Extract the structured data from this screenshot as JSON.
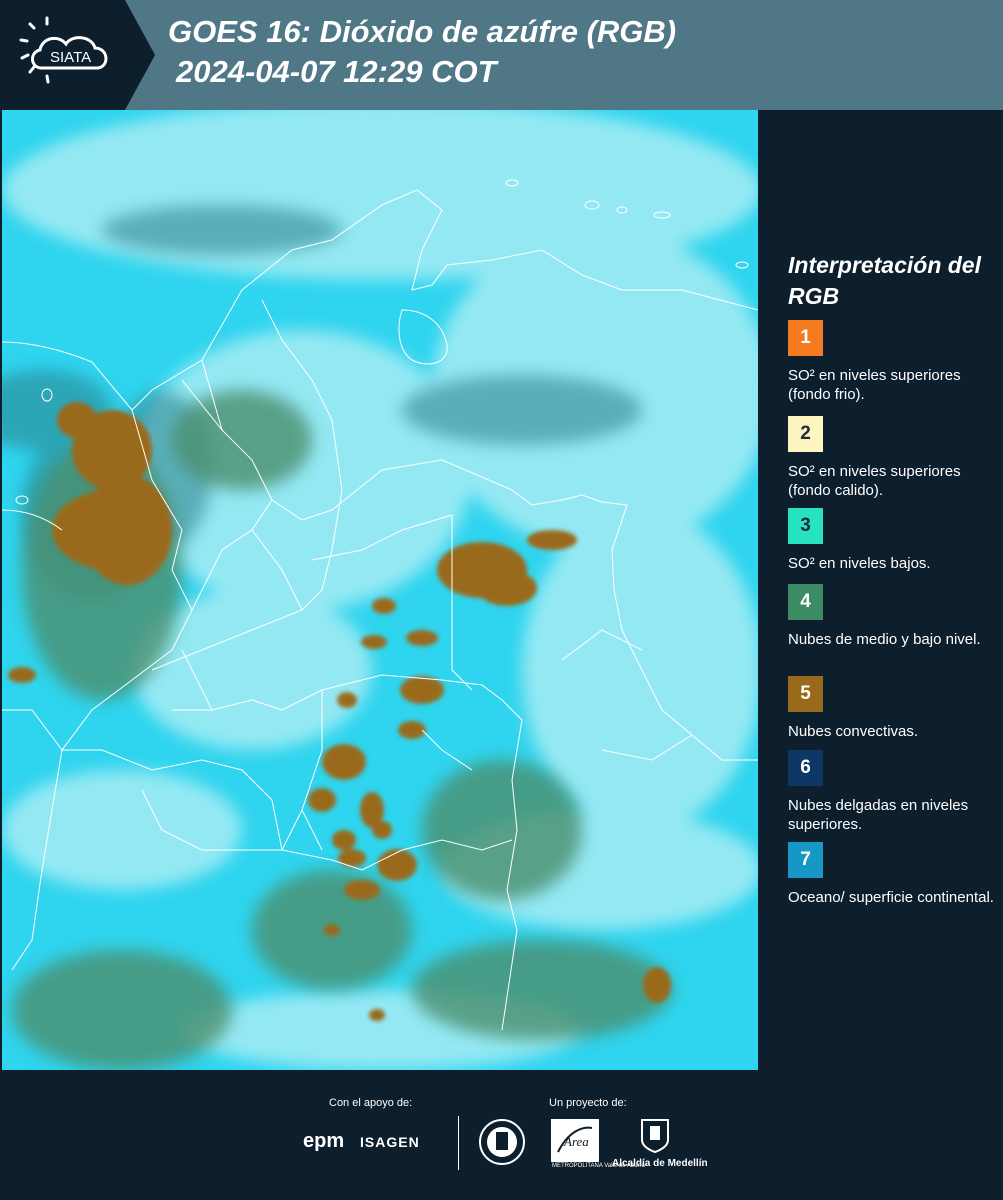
{
  "header": {
    "logo_text": "SIATA",
    "title_line1": "GOES 16: Dióxido de azúfre (RGB)",
    "title_line2": "2024-04-07 12:29 COT"
  },
  "map": {
    "base_color": "#2fd4ee",
    "cloud_color": "#9be8f2",
    "green_color": "#4c8f6e",
    "convective_color": "#9a6b1e",
    "border_color": "#ffffff"
  },
  "legend": {
    "title": "Interpretación del RGB",
    "items": [
      {
        "number": "1",
        "color": "#f47b20",
        "label": "SO² en niveles superiores (fondo frio)."
      },
      {
        "number": "2",
        "color": "#fdf5c0",
        "label": "SO² en niveles superiores (fondo calido)."
      },
      {
        "number": "3",
        "color": "#27e3c0",
        "label": "SO² en niveles bajos."
      },
      {
        "number": "4",
        "color": "#3d8c64",
        "label": "Nubes de medio y bajo nivel."
      },
      {
        "number": "5",
        "color": "#9a6a1c",
        "label": "Nubes convectivas."
      },
      {
        "number": "6",
        "color": "#0d3765",
        "label": "Nubes delgadas en niveles superiores."
      },
      {
        "number": "7",
        "color": "#1697c6",
        "label": "Oceano/ superficie continental."
      }
    ]
  },
  "footer": {
    "support_label": "Con el apoyo de:",
    "project_label": "Un proyecto de:",
    "epm": "epm",
    "isagen": "ISAGEN",
    "area_metropolitana": "METROPOLITANA Valle de Aburrá",
    "alcaldia": "Alcaldía de Medellín"
  }
}
